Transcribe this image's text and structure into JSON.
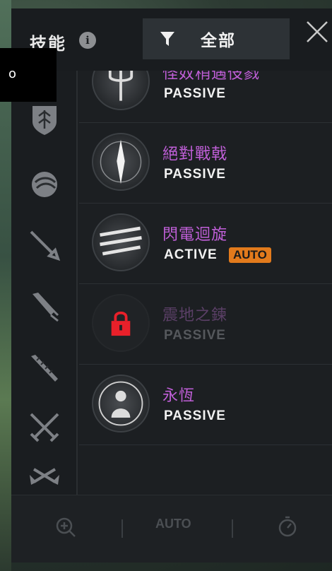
{
  "header": {
    "title": "技能",
    "info_icon": "info-icon",
    "filter_label": "全部",
    "filter_icon": "funnel-icon",
    "close_icon": "close-icon"
  },
  "sidebar": {
    "icons": [
      "shield-emblem-icon",
      "orb-icon",
      "sword-icon",
      "greatsword-icon",
      "spiked-blade-icon",
      "crossed-swords-icon",
      "crossed-axes-icon"
    ]
  },
  "skills": [
    {
      "name": "怪奴稍遇伎戮",
      "type": "PASSIVE",
      "auto": "",
      "locked": false,
      "icon": "trident-icon"
    },
    {
      "name": "絕對戰戟",
      "type": "PASSIVE",
      "auto": "",
      "locked": false,
      "icon": "glowing-spear-icon"
    },
    {
      "name": "閃電迴旋",
      "type": "ACTIVE",
      "auto": "AUTO",
      "locked": false,
      "icon": "lightning-slash-icon"
    },
    {
      "name": "震地之鍊",
      "type": "PASSIVE",
      "auto": "",
      "locked": true,
      "icon": "lock-icon"
    },
    {
      "name": "永恆",
      "type": "PASSIVE",
      "auto": "",
      "locked": false,
      "icon": "meditating-figure-icon"
    }
  ],
  "footer": {
    "zoom_icon": "zoom-in-icon",
    "auto_label": "AUTO",
    "timer_icon": "stopwatch-icon"
  },
  "overlay": {
    "text": "o"
  },
  "colors": {
    "skill_name": "#c05fd8",
    "auto_badge": "#e27a1c",
    "lock": "#e8202a"
  }
}
